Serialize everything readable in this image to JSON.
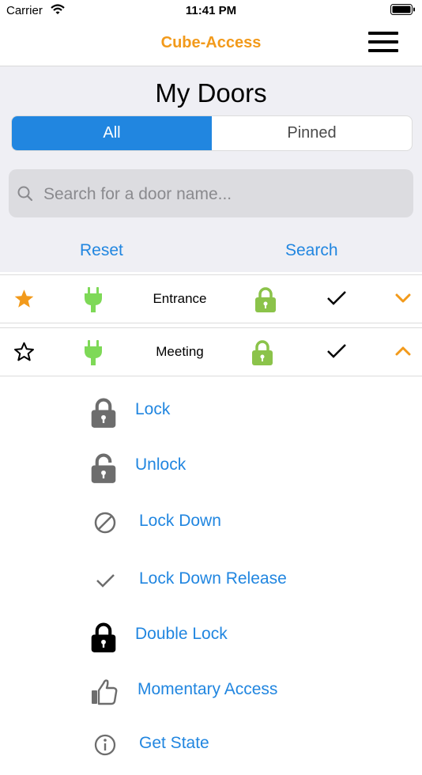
{
  "status": {
    "carrier": "Carrier",
    "time": "11:41 PM"
  },
  "nav": {
    "title": "Cube-Access",
    "menu_icon": "hamburger-icon"
  },
  "page": {
    "title": "My Doors"
  },
  "segments": {
    "all": "All",
    "pinned": "Pinned",
    "selected": "All"
  },
  "search": {
    "placeholder": "Search for a door name...",
    "value": ""
  },
  "actions_bar": {
    "reset": "Reset",
    "search": "Search"
  },
  "doors": [
    {
      "name": "Entrance",
      "pinned": true,
      "expanded": false
    },
    {
      "name": "Meeting",
      "pinned": false,
      "expanded": true
    }
  ],
  "door_actions": [
    {
      "label": "Lock",
      "icon": "lock-closed-icon"
    },
    {
      "label": "Unlock",
      "icon": "lock-open-icon"
    },
    {
      "label": "Lock Down",
      "icon": "prohibit-icon"
    },
    {
      "label": "Lock Down Release",
      "icon": "check-icon"
    },
    {
      "label": "Double Lock",
      "icon": "lock-closed-black-icon"
    },
    {
      "label": "Momentary Access",
      "icon": "thumbs-up-icon"
    },
    {
      "label": "Get State",
      "icon": "info-icon"
    }
  ],
  "colors": {
    "accent": "#f29a1b",
    "blue": "#2186e0",
    "green": "#7ed957",
    "lockGreen": "#8bc34a",
    "grey": "#6d6d6d"
  }
}
